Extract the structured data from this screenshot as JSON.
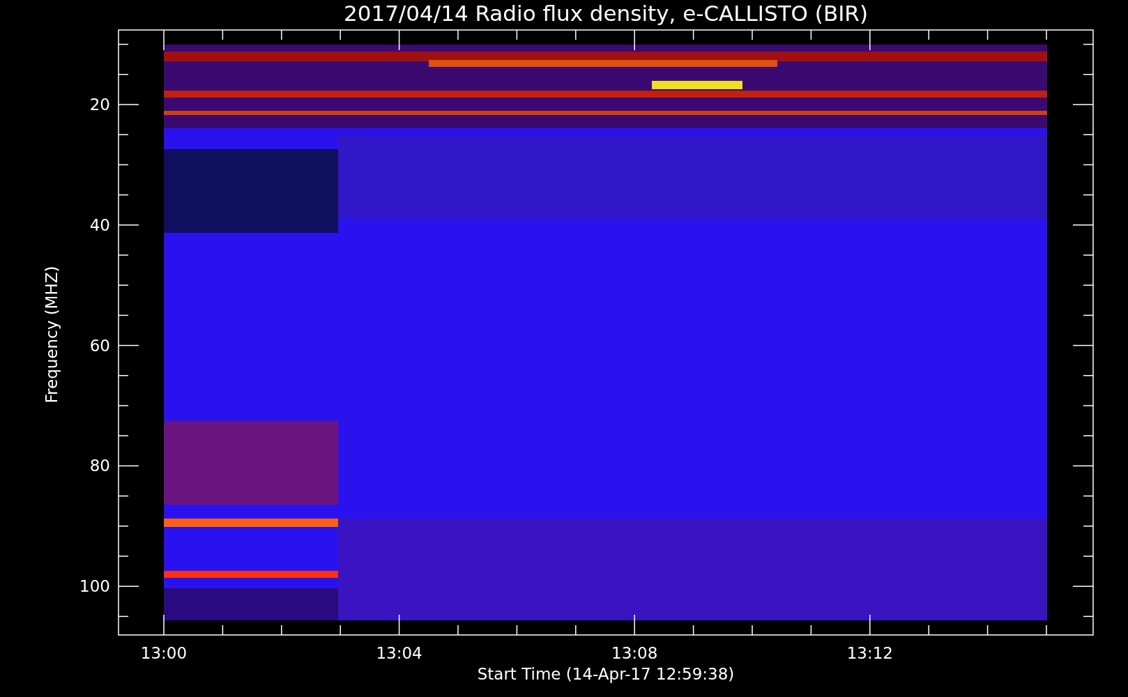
{
  "plot": {
    "title": "2017/04/14  Radio flux density, e-CALLISTO (BIR)",
    "ylabel": "Frequency (MHZ)",
    "xlabel": "Start Time (14-Apr-17 12:59:38)",
    "y_ticks": [
      {
        "label": "20"
      },
      {
        "label": "40"
      },
      {
        "label": "60"
      },
      {
        "label": "80"
      },
      {
        "label": "100"
      }
    ],
    "x_ticks": [
      {
        "label": "13:00"
      },
      {
        "label": "13:04"
      },
      {
        "label": "13:08"
      },
      {
        "label": "13:12"
      }
    ]
  }
}
